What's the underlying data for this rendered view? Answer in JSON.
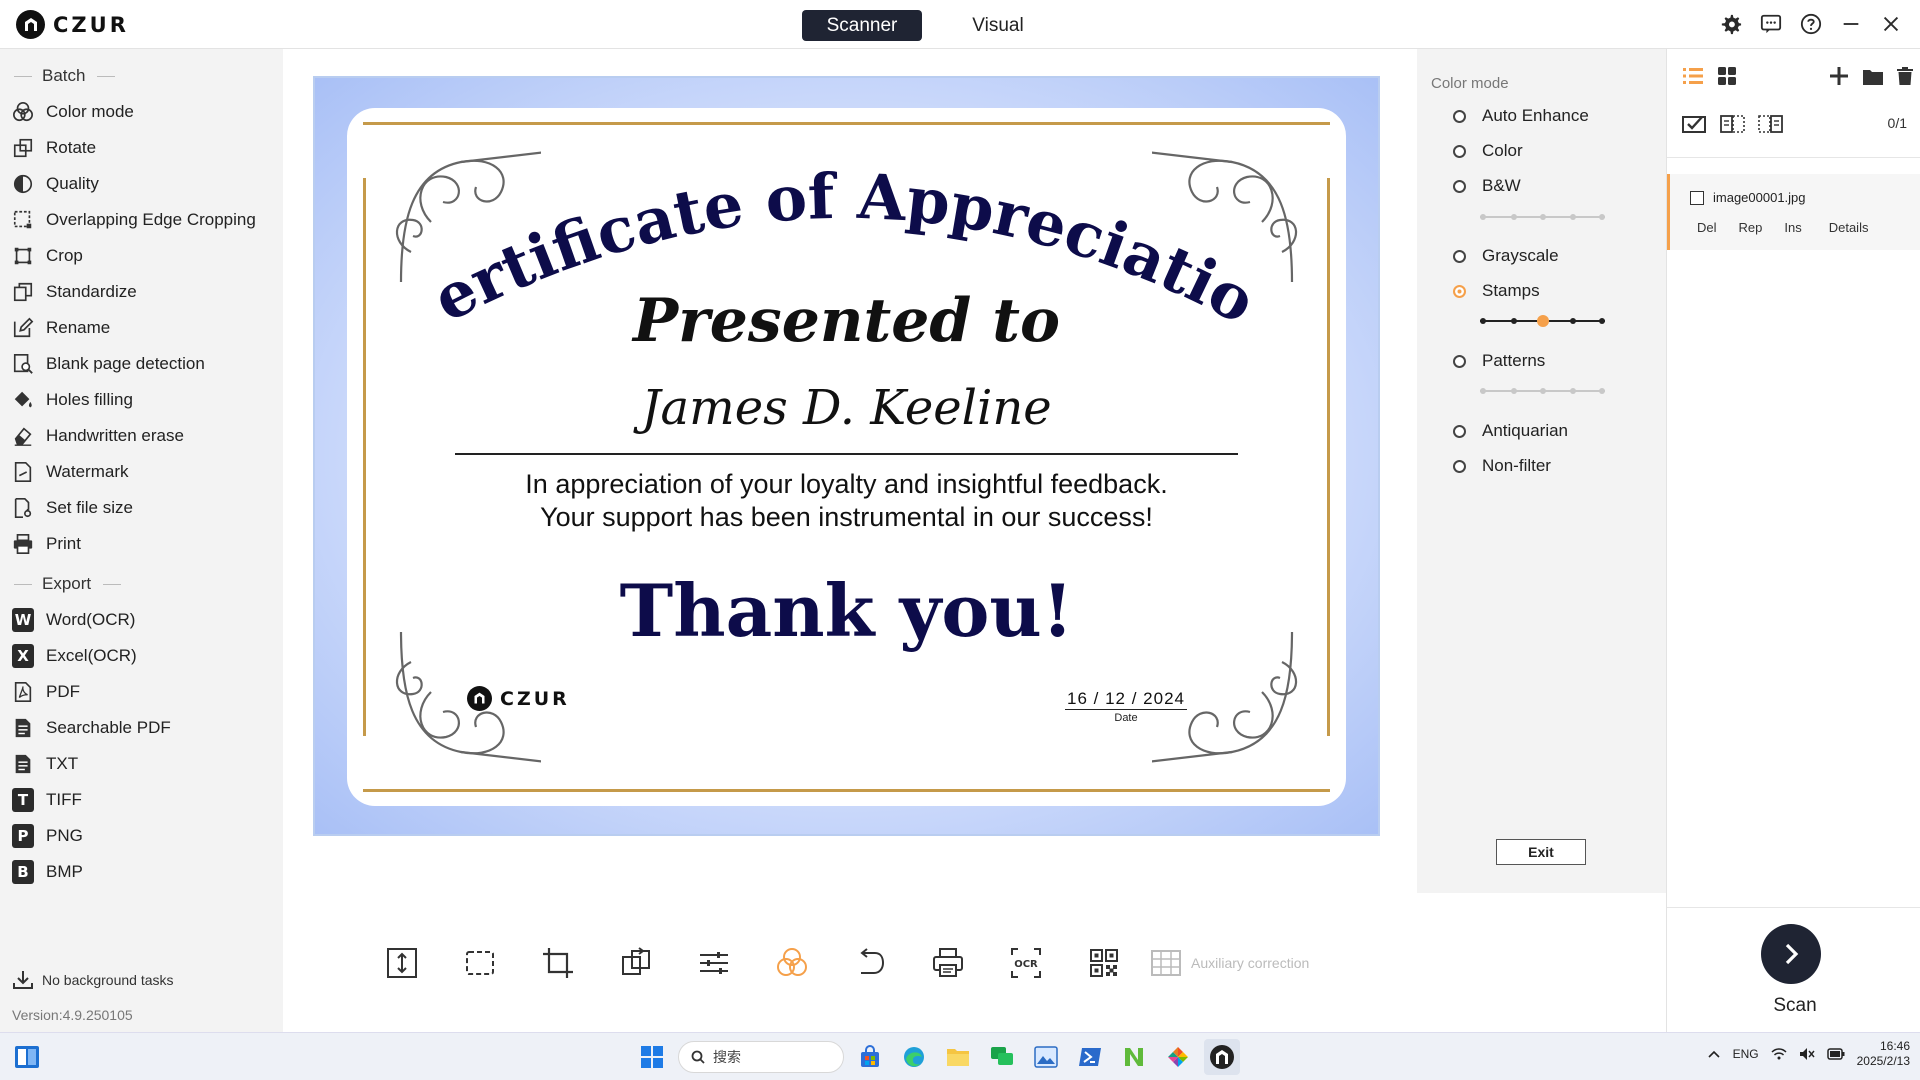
{
  "app": {
    "logo_text": "CZUR",
    "mode_tabs": [
      {
        "label": "Scanner",
        "active": true
      },
      {
        "label": "Visual",
        "active": false
      }
    ],
    "top_icons": [
      "gear-icon",
      "chat-icon",
      "help-icon",
      "minimize-icon",
      "close-icon"
    ]
  },
  "sidebar": {
    "batch_title": "Batch",
    "batch_items": [
      {
        "label": "Color mode",
        "icon": "color-mode-icon"
      },
      {
        "label": "Rotate",
        "icon": "rotate-icon"
      },
      {
        "label": "Quality",
        "icon": "quality-icon"
      },
      {
        "label": "Overlapping Edge Cropping",
        "icon": "edge-crop-icon"
      },
      {
        "label": "Crop",
        "icon": "crop-icon"
      },
      {
        "label": "Standardize",
        "icon": "standardize-icon"
      },
      {
        "label": "Rename",
        "icon": "rename-icon"
      },
      {
        "label": "Blank page detection",
        "icon": "blank-page-icon"
      },
      {
        "label": "Holes filling",
        "icon": "holes-filling-icon"
      },
      {
        "label": "Handwritten erase",
        "icon": "eraser-icon"
      },
      {
        "label": "Watermark",
        "icon": "watermark-icon"
      },
      {
        "label": "Set file size",
        "icon": "file-size-icon"
      },
      {
        "label": "Print",
        "icon": "print-icon"
      }
    ],
    "export_title": "Export",
    "export_items": [
      {
        "label": "Word(OCR)",
        "glyph": "W"
      },
      {
        "label": "Excel(OCR)",
        "glyph": "X"
      },
      {
        "label": "PDF",
        "glyph": "pdf"
      },
      {
        "label": "Searchable PDF",
        "glyph": "doc"
      },
      {
        "label": "TXT",
        "glyph": "doc"
      },
      {
        "label": "TIFF",
        "glyph": "T"
      },
      {
        "label": "PNG",
        "glyph": "P"
      },
      {
        "label": "BMP",
        "glyph": "B"
      }
    ],
    "background_tasks": "No background tasks",
    "version": "Version:4.9.250105"
  },
  "certificate": {
    "title": "Certificate of Appreciation",
    "presented": "Presented to",
    "name": "James D. Keeline",
    "message_line1": "In appreciation of your loyalty and insightful feedback.",
    "message_line2": "Your support has been instrumental in our success!",
    "thanks": "Thank you!",
    "logo_text": "CZUR",
    "date": "16 / 12 / 2024",
    "date_label": "Date"
  },
  "toolbar": {
    "tools": [
      "fit-height-icon",
      "select-area-icon",
      "crop-icon",
      "rotate-icon",
      "adjust-icon",
      "color-mode-icon",
      "undo-icon",
      "print-icon",
      "ocr-icon",
      "qr-code-icon"
    ],
    "active_tool": "color-mode-icon",
    "auxiliary_label": "Auxiliary correction"
  },
  "color_mode": {
    "title": "Color mode",
    "options": [
      {
        "label": "Auto Enhance",
        "selected": false,
        "slider": null
      },
      {
        "label": "Color",
        "selected": false,
        "slider": null
      },
      {
        "label": "B&W",
        "selected": false,
        "slider": 0.5
      },
      {
        "label": "Grayscale",
        "selected": false,
        "slider": null
      },
      {
        "label": "Stamps",
        "selected": true,
        "slider": 0.5
      },
      {
        "label": "Patterns",
        "selected": false,
        "slider": 0.5
      },
      {
        "label": "Antiquarian",
        "selected": false,
        "slider": null
      },
      {
        "label": "Non-filter",
        "selected": false,
        "slider": null
      }
    ],
    "exit_label": "Exit",
    "accent": "#f5a04a"
  },
  "file_panel": {
    "count": "0/1",
    "file": {
      "name": "image00001.jpg",
      "actions": [
        "Del",
        "Rep",
        "Ins",
        "Details"
      ]
    },
    "scan_label": "Scan"
  },
  "taskbar": {
    "search_placeholder": "搜索",
    "lang": "ENG",
    "time": "16:46",
    "date": "2025/2/13"
  }
}
